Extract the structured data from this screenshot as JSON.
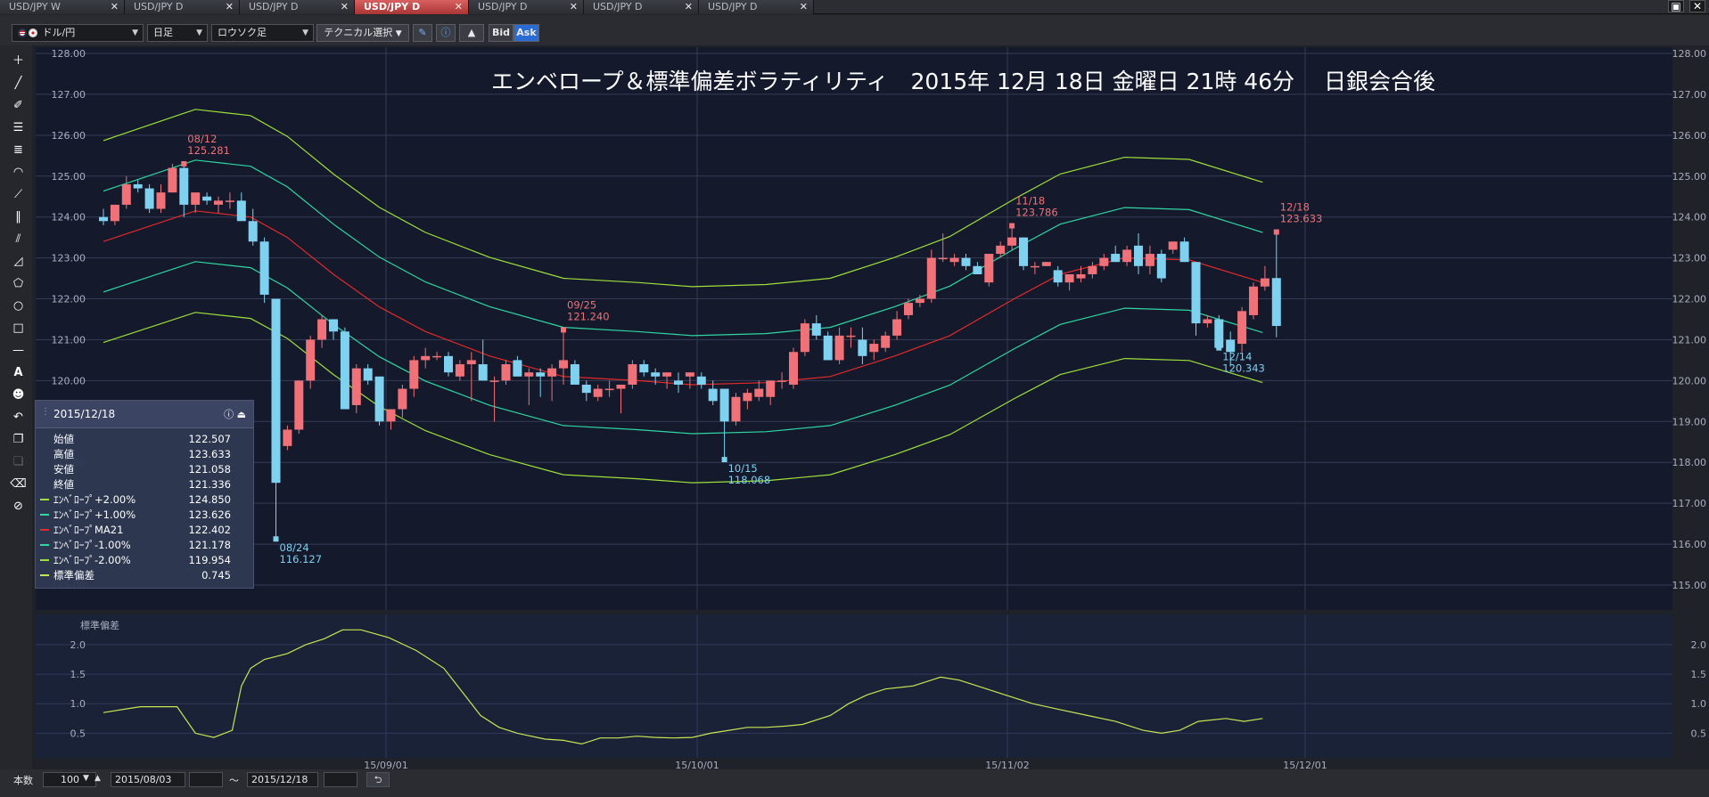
{
  "tabs": [
    {
      "label": "USD/JPY W",
      "active": false
    },
    {
      "label": "USD/JPY D",
      "active": false
    },
    {
      "label": "USD/JPY D",
      "active": false
    },
    {
      "label": "USD/JPY D",
      "active": true
    },
    {
      "label": "USD/JPY D",
      "active": false
    },
    {
      "label": "USD/JPY D",
      "active": false
    },
    {
      "label": "USD/JPY D",
      "active": false
    }
  ],
  "toolbar": {
    "symbol": "ドル/円",
    "timeframe": "日足",
    "chart_type": "ロウソク足",
    "technical": "テクニカル選択",
    "bid": "Bid",
    "ask": "Ask"
  },
  "chart_title": "エンベロープ＆標準偏差ボラティリティ　2015年 12月 18日 金曜日 21時 46分　 日銀会合後",
  "colors": {
    "up": "#f07177",
    "down": "#7fd1f0",
    "ma": "#e02a2a",
    "env1": "#2fd7a3",
    "env2": "#9ee03b",
    "sd": "#c9e552",
    "bg": "#14192c",
    "grid": "#343c55"
  },
  "info_panel": {
    "date": "2015/12/18",
    "rows": [
      {
        "label": "始値",
        "value": "122.507"
      },
      {
        "label": "高値",
        "value": "123.633"
      },
      {
        "label": "安値",
        "value": "121.058"
      },
      {
        "label": "終値",
        "value": "121.336"
      },
      {
        "label": "ｴﾝﾍﾞﾛｰﾌﾟ+2.00%",
        "value": "124.850",
        "color": "#9ee03b"
      },
      {
        "label": "ｴﾝﾍﾞﾛｰﾌﾟ+1.00%",
        "value": "123.626",
        "color": "#2fd7a3"
      },
      {
        "label": "ｴﾝﾍﾞﾛｰﾌﾟMA21",
        "value": "122.402",
        "color": "#e02a2a"
      },
      {
        "label": "ｴﾝﾍﾞﾛｰﾌﾟ-1.00%",
        "value": "121.178",
        "color": "#2fd7a3"
      },
      {
        "label": "ｴﾝﾍﾞﾛｰﾌﾟ-2.00%",
        "value": "119.954",
        "color": "#9ee03b"
      },
      {
        "label": "標準偏差",
        "value": "0.745",
        "color": "#c9e552"
      }
    ]
  },
  "annotations": [
    {
      "date": "08/12",
      "value": "125.281",
      "kind": "high"
    },
    {
      "date": "08/24",
      "value": "116.127",
      "kind": "low"
    },
    {
      "date": "09/25",
      "value": "121.240",
      "kind": "high"
    },
    {
      "date": "10/15",
      "value": "118.068",
      "kind": "low"
    },
    {
      "date": "11/18",
      "value": "123.786",
      "kind": "high"
    },
    {
      "date": "12/14",
      "value": "120.343",
      "kind": "low"
    },
    {
      "date": "12/18",
      "value": "123.633",
      "kind": "high"
    }
  ],
  "sub_chart_label": "標準偏差",
  "x_labels": [
    "15/09/01",
    "15/10/01",
    "15/11/02",
    "15/12/01"
  ],
  "footer": {
    "count_label": "本数",
    "count_value": "100",
    "start_date": "2015/08/03",
    "tilde": "～",
    "end_date": "2015/12/18"
  },
  "chart_data": {
    "type": "candlestick",
    "main_axis": {
      "ylim": [
        115,
        128
      ],
      "ticks": [
        "128.00",
        "127.00",
        "126.00",
        "125.00",
        "124.00",
        "123.00",
        "122.00",
        "121.00",
        "120.00",
        "119.00",
        "118.00",
        "117.00",
        "116.00",
        "115.00"
      ]
    },
    "sub_axis": {
      "ylim": [
        0.25,
        2.3
      ],
      "ticks": [
        "2.0",
        "1.5",
        "1.0",
        "0.5"
      ]
    },
    "candles": [
      [
        124.0,
        124.2,
        123.8,
        123.9
      ],
      [
        123.9,
        124.3,
        123.8,
        124.3
      ],
      [
        124.3,
        125.0,
        124.2,
        124.8
      ],
      [
        124.8,
        124.9,
        124.6,
        124.7
      ],
      [
        124.7,
        124.8,
        124.1,
        124.2
      ],
      [
        124.2,
        124.8,
        124.1,
        124.6
      ],
      [
        124.6,
        125.3,
        124.6,
        125.2
      ],
      [
        125.2,
        125.3,
        124.0,
        124.3
      ],
      [
        124.3,
        124.6,
        124.1,
        124.6
      ],
      [
        124.5,
        124.6,
        124.3,
        124.4
      ],
      [
        124.3,
        124.5,
        124.1,
        124.4
      ],
      [
        124.4,
        124.6,
        124.2,
        124.4
      ],
      [
        124.4,
        124.6,
        124.0,
        123.9
      ],
      [
        123.9,
        124.2,
        123.3,
        123.4
      ],
      [
        123.4,
        123.5,
        121.9,
        122.1
      ],
      [
        122.0,
        122.0,
        116.127,
        117.5
      ],
      [
        118.4,
        118.9,
        118.3,
        118.8
      ],
      [
        118.8,
        120.0,
        118.7,
        120.0
      ],
      [
        120.0,
        121.1,
        119.8,
        121.0
      ],
      [
        121.0,
        121.6,
        120.8,
        121.5
      ],
      [
        121.5,
        121.5,
        121.0,
        121.2
      ],
      [
        121.2,
        121.3,
        119.3,
        119.3
      ],
      [
        119.4,
        120.4,
        119.2,
        120.3
      ],
      [
        120.3,
        120.4,
        119.9,
        120.0
      ],
      [
        120.1,
        120.1,
        118.9,
        119.0
      ],
      [
        119.0,
        119.3,
        118.8,
        119.3
      ],
      [
        119.3,
        119.9,
        119.1,
        119.8
      ],
      [
        119.8,
        120.6,
        119.6,
        120.5
      ],
      [
        120.5,
        120.8,
        120.3,
        120.6
      ],
      [
        120.6,
        120.7,
        120.5,
        120.6
      ],
      [
        120.6,
        120.7,
        120.1,
        120.2
      ],
      [
        120.1,
        120.5,
        120.0,
        120.4
      ],
      [
        120.4,
        120.7,
        119.5,
        120.5
      ],
      [
        120.4,
        121.0,
        120.0,
        120.0
      ],
      [
        120.0,
        120.1,
        119.0,
        120.0
      ],
      [
        120.0,
        120.5,
        119.9,
        120.4
      ],
      [
        120.5,
        120.6,
        120.1,
        120.1
      ],
      [
        120.1,
        120.3,
        119.4,
        120.2
      ],
      [
        120.2,
        120.3,
        119.6,
        120.1
      ],
      [
        120.1,
        120.4,
        119.5,
        120.3
      ],
      [
        120.3,
        121.24,
        119.9,
        120.5
      ],
      [
        120.4,
        120.5,
        119.9,
        119.9
      ],
      [
        119.9,
        120.0,
        119.5,
        119.7
      ],
      [
        119.6,
        119.9,
        119.5,
        119.8
      ],
      [
        119.8,
        120.0,
        119.6,
        119.8
      ],
      [
        119.8,
        119.9,
        119.2,
        119.9
      ],
      [
        119.9,
        120.5,
        119.8,
        120.4
      ],
      [
        120.4,
        120.5,
        120.1,
        120.2
      ],
      [
        120.2,
        120.3,
        119.9,
        120.1
      ],
      [
        120.1,
        120.2,
        119.8,
        120.2
      ],
      [
        120.0,
        120.2,
        119.7,
        119.9
      ],
      [
        120.1,
        120.2,
        119.8,
        120.2
      ],
      [
        120.1,
        120.2,
        119.8,
        119.9
      ],
      [
        119.8,
        120.0,
        119.4,
        119.5
      ],
      [
        119.8,
        119.8,
        118.068,
        119.0
      ],
      [
        119.0,
        119.7,
        118.9,
        119.6
      ],
      [
        119.5,
        119.8,
        119.3,
        119.7
      ],
      [
        119.6,
        120.0,
        119.5,
        119.8
      ],
      [
        119.6,
        120.0,
        119.4,
        120.0
      ],
      [
        120.0,
        120.2,
        119.8,
        120.0
      ],
      [
        119.9,
        120.8,
        119.8,
        120.7
      ],
      [
        120.7,
        121.5,
        120.6,
        121.4
      ],
      [
        121.4,
        121.6,
        121.0,
        121.1
      ],
      [
        121.1,
        121.2,
        120.5,
        120.5
      ],
      [
        120.5,
        121.3,
        120.4,
        121.1
      ],
      [
        121.1,
        121.3,
        120.8,
        121.1
      ],
      [
        121.0,
        121.3,
        120.4,
        120.6
      ],
      [
        120.7,
        121.0,
        120.5,
        120.9
      ],
      [
        120.8,
        121.2,
        120.7,
        121.1
      ],
      [
        121.1,
        121.7,
        121.0,
        121.5
      ],
      [
        121.6,
        122.0,
        121.5,
        121.9
      ],
      [
        121.9,
        122.1,
        121.8,
        122.0
      ],
      [
        122.0,
        123.2,
        121.9,
        123.0
      ],
      [
        123.0,
        123.6,
        122.9,
        123.0
      ],
      [
        122.9,
        123.1,
        122.8,
        123.0
      ],
      [
        123.0,
        123.1,
        122.7,
        122.8
      ],
      [
        122.8,
        122.9,
        122.6,
        122.6
      ],
      [
        122.4,
        123.1,
        122.3,
        123.1
      ],
      [
        123.1,
        123.4,
        123.0,
        123.3
      ],
      [
        123.3,
        123.786,
        123.2,
        123.5
      ],
      [
        123.5,
        123.5,
        122.7,
        122.8
      ],
      [
        122.8,
        122.9,
        122.6,
        122.8
      ],
      [
        122.8,
        122.9,
        122.8,
        122.9
      ],
      [
        122.7,
        122.8,
        122.3,
        122.4
      ],
      [
        122.4,
        122.6,
        122.2,
        122.6
      ],
      [
        122.5,
        122.8,
        122.4,
        122.6
      ],
      [
        122.6,
        122.9,
        122.5,
        122.8
      ],
      [
        122.8,
        123.1,
        122.7,
        123.0
      ],
      [
        123.1,
        123.3,
        122.9,
        122.9
      ],
      [
        122.9,
        123.3,
        122.8,
        123.2
      ],
      [
        123.3,
        123.6,
        122.6,
        122.8
      ],
      [
        122.8,
        123.3,
        122.6,
        123.1
      ],
      [
        123.1,
        123.2,
        122.4,
        122.5
      ],
      [
        123.2,
        123.4,
        123.1,
        123.4
      ],
      [
        123.4,
        123.5,
        122.9,
        122.9
      ],
      [
        122.9,
        122.9,
        121.1,
        121.4
      ],
      [
        121.4,
        121.6,
        121.3,
        121.5
      ],
      [
        121.5,
        121.6,
        120.8,
        120.8
      ],
      [
        121.0,
        121.2,
        120.343,
        120.7
      ],
      [
        120.9,
        121.8,
        120.7,
        121.7
      ],
      [
        121.6,
        122.4,
        121.5,
        122.3
      ],
      [
        122.3,
        122.8,
        122.2,
        122.5
      ],
      [
        122.507,
        123.633,
        121.058,
        121.336
      ]
    ],
    "ma21_points": [
      [
        0,
        123.4
      ],
      [
        10,
        124.15
      ],
      [
        16,
        124.0
      ],
      [
        20,
        123.5
      ],
      [
        25,
        122.6
      ],
      [
        30,
        121.8
      ],
      [
        35,
        121.2
      ],
      [
        42,
        120.6
      ],
      [
        50,
        120.1
      ],
      [
        58,
        120.0
      ],
      [
        64,
        119.9
      ],
      [
        72,
        119.95
      ],
      [
        79,
        120.1
      ],
      [
        86,
        120.6
      ],
      [
        92,
        121.1
      ],
      [
        99,
        122.0
      ],
      [
        104,
        122.6
      ],
      [
        111,
        123.0
      ],
      [
        118,
        122.95
      ],
      [
        126,
        122.4
      ]
    ],
    "sd_points": [
      [
        0,
        0.85
      ],
      [
        4,
        0.9
      ],
      [
        8,
        0.95
      ],
      [
        12,
        0.95
      ],
      [
        16,
        0.95
      ],
      [
        20,
        0.5
      ],
      [
        24,
        0.43
      ],
      [
        28,
        0.55
      ],
      [
        30,
        1.3
      ],
      [
        32,
        1.6
      ],
      [
        35,
        1.75
      ],
      [
        40,
        1.85
      ],
      [
        44,
        2.0
      ],
      [
        48,
        2.1
      ],
      [
        52,
        2.25
      ],
      [
        56,
        2.25
      ],
      [
        62,
        2.12
      ],
      [
        68,
        1.9
      ],
      [
        74,
        1.6
      ],
      [
        78,
        1.2
      ],
      [
        82,
        0.8
      ],
      [
        86,
        0.6
      ],
      [
        90,
        0.5
      ],
      [
        96,
        0.4
      ],
      [
        100,
        0.38
      ],
      [
        104,
        0.32
      ],
      [
        108,
        0.42
      ],
      [
        112,
        0.42
      ],
      [
        116,
        0.45
      ],
      [
        120,
        0.43
      ],
      [
        124,
        0.42
      ],
      [
        128,
        0.43
      ],
      [
        132,
        0.5
      ],
      [
        136,
        0.55
      ],
      [
        140,
        0.6
      ],
      [
        144,
        0.6
      ],
      [
        148,
        0.62
      ],
      [
        152,
        0.65
      ],
      [
        158,
        0.8
      ],
      [
        162,
        1.0
      ],
      [
        166,
        1.15
      ],
      [
        170,
        1.25
      ],
      [
        176,
        1.3
      ],
      [
        182,
        1.45
      ],
      [
        186,
        1.4
      ],
      [
        190,
        1.3
      ],
      [
        196,
        1.15
      ],
      [
        202,
        1.0
      ],
      [
        208,
        0.9
      ],
      [
        214,
        0.8
      ],
      [
        220,
        0.7
      ],
      [
        226,
        0.55
      ],
      [
        230,
        0.5
      ],
      [
        234,
        0.55
      ],
      [
        238,
        0.7
      ],
      [
        244,
        0.75
      ],
      [
        248,
        0.7
      ],
      [
        252,
        0.75
      ]
    ],
    "candle_x_start": 80,
    "candle_x_step": 12.9
  }
}
